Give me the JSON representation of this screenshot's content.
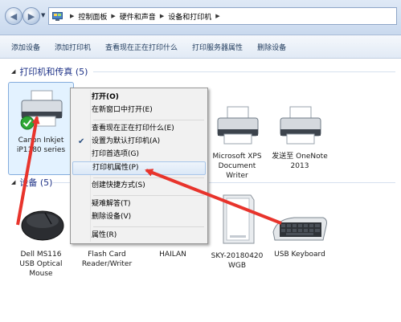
{
  "address_bar": {
    "breadcrumbs": [
      "控制面板",
      "硬件和声音",
      "设备和打印机"
    ]
  },
  "toolbar": {
    "items": [
      "添加设备",
      "添加打印机",
      "查看现在正在打印什么",
      "打印服务器属性",
      "删除设备"
    ]
  },
  "groups": {
    "printers": {
      "title": "打印机和传真 (5)",
      "devices": [
        {
          "name": "Canon Inkjet iP1180 series",
          "line1": "Canon Inkjet",
          "line2": "iP1180 series",
          "icon": "printer-icon",
          "default": true
        },
        {
          "name": "Microsoft XPS Document Writer",
          "line1": "Microsoft XPS",
          "line2": "Document",
          "line3": "Writer",
          "icon": "printer-icon"
        },
        {
          "name": "发送至 OneNote 2013",
          "line1": "发送至 OneNote",
          "line2": "2013",
          "icon": "printer-icon"
        }
      ]
    },
    "devices": {
      "title": "设备 (5)",
      "items": [
        {
          "line1": "Dell MS116",
          "line2": "USB Optical",
          "line3": "Mouse",
          "icon": "mouse-icon"
        },
        {
          "line1": "Flash Card",
          "line2": "Reader/Writer",
          "icon": "card-reader-icon"
        },
        {
          "line1": "HAILAN",
          "icon": "computer-icon"
        },
        {
          "line1": "SKY-20180420",
          "line2": "WGB",
          "icon": "tower-pc-icon"
        },
        {
          "line1": "USB Keyboard",
          "icon": "keyboard-icon"
        }
      ]
    }
  },
  "context_menu": {
    "items": [
      {
        "label": "打开(O)",
        "bold": true
      },
      {
        "label": "在新窗口中打开(E)"
      },
      {
        "label": "查看现在正在打印什么(E)"
      },
      {
        "label": "设置为默认打印机(A)",
        "checked": true
      },
      {
        "label": "打印首选项(G)"
      },
      {
        "label": "打印机属性(P)",
        "highlighted": true
      },
      {
        "label": "创建快捷方式(S)"
      },
      {
        "label": "疑难解答(T)"
      },
      {
        "label": "删除设备(V)"
      },
      {
        "label": "属性(R)"
      }
    ]
  },
  "colors": {
    "accent_text": "#1e3287",
    "arrow": "#e8342c",
    "default_check": "#2fa836"
  }
}
